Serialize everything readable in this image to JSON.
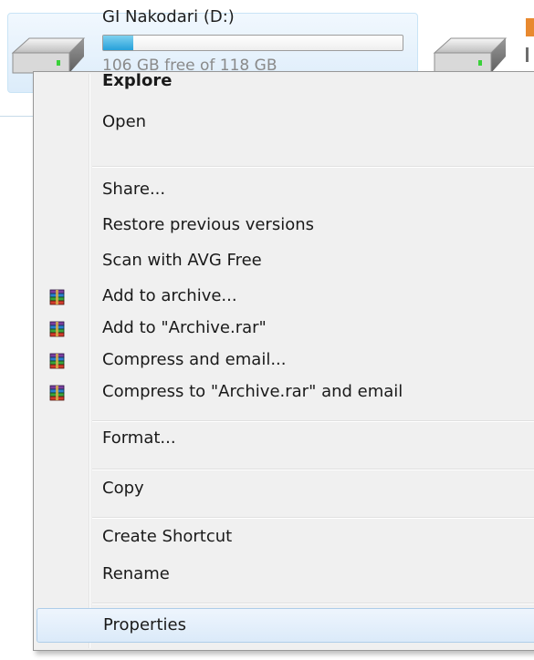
{
  "drive": {
    "name": "GI Nakodari (D:)",
    "free_text": "106 GB free of 118 GB",
    "used_fraction": 0.1
  },
  "context_menu": {
    "explore": "Explore",
    "open": "Open",
    "share": "Share...",
    "restore": "Restore previous versions",
    "scan": "Scan with AVG Free",
    "add_archive": "Add to archive...",
    "add_rar": "Add to \"Archive.rar\"",
    "compress_email": "Compress and email...",
    "compress_rar_email": "Compress to \"Archive.rar\" and email",
    "format": "Format...",
    "copy": "Copy",
    "create_shortcut": "Create Shortcut",
    "rename": "Rename",
    "properties": "Properties"
  },
  "icons": {
    "drive": "hard-drive-icon",
    "winrar": "winrar-books-icon"
  },
  "colors": {
    "selection_bg": "#dcecfa",
    "selection_border": "#c9e4f6",
    "capacity_fill": "#26a0da",
    "menu_bg": "#f0f0f0",
    "highlight_border": "#aecde9"
  }
}
